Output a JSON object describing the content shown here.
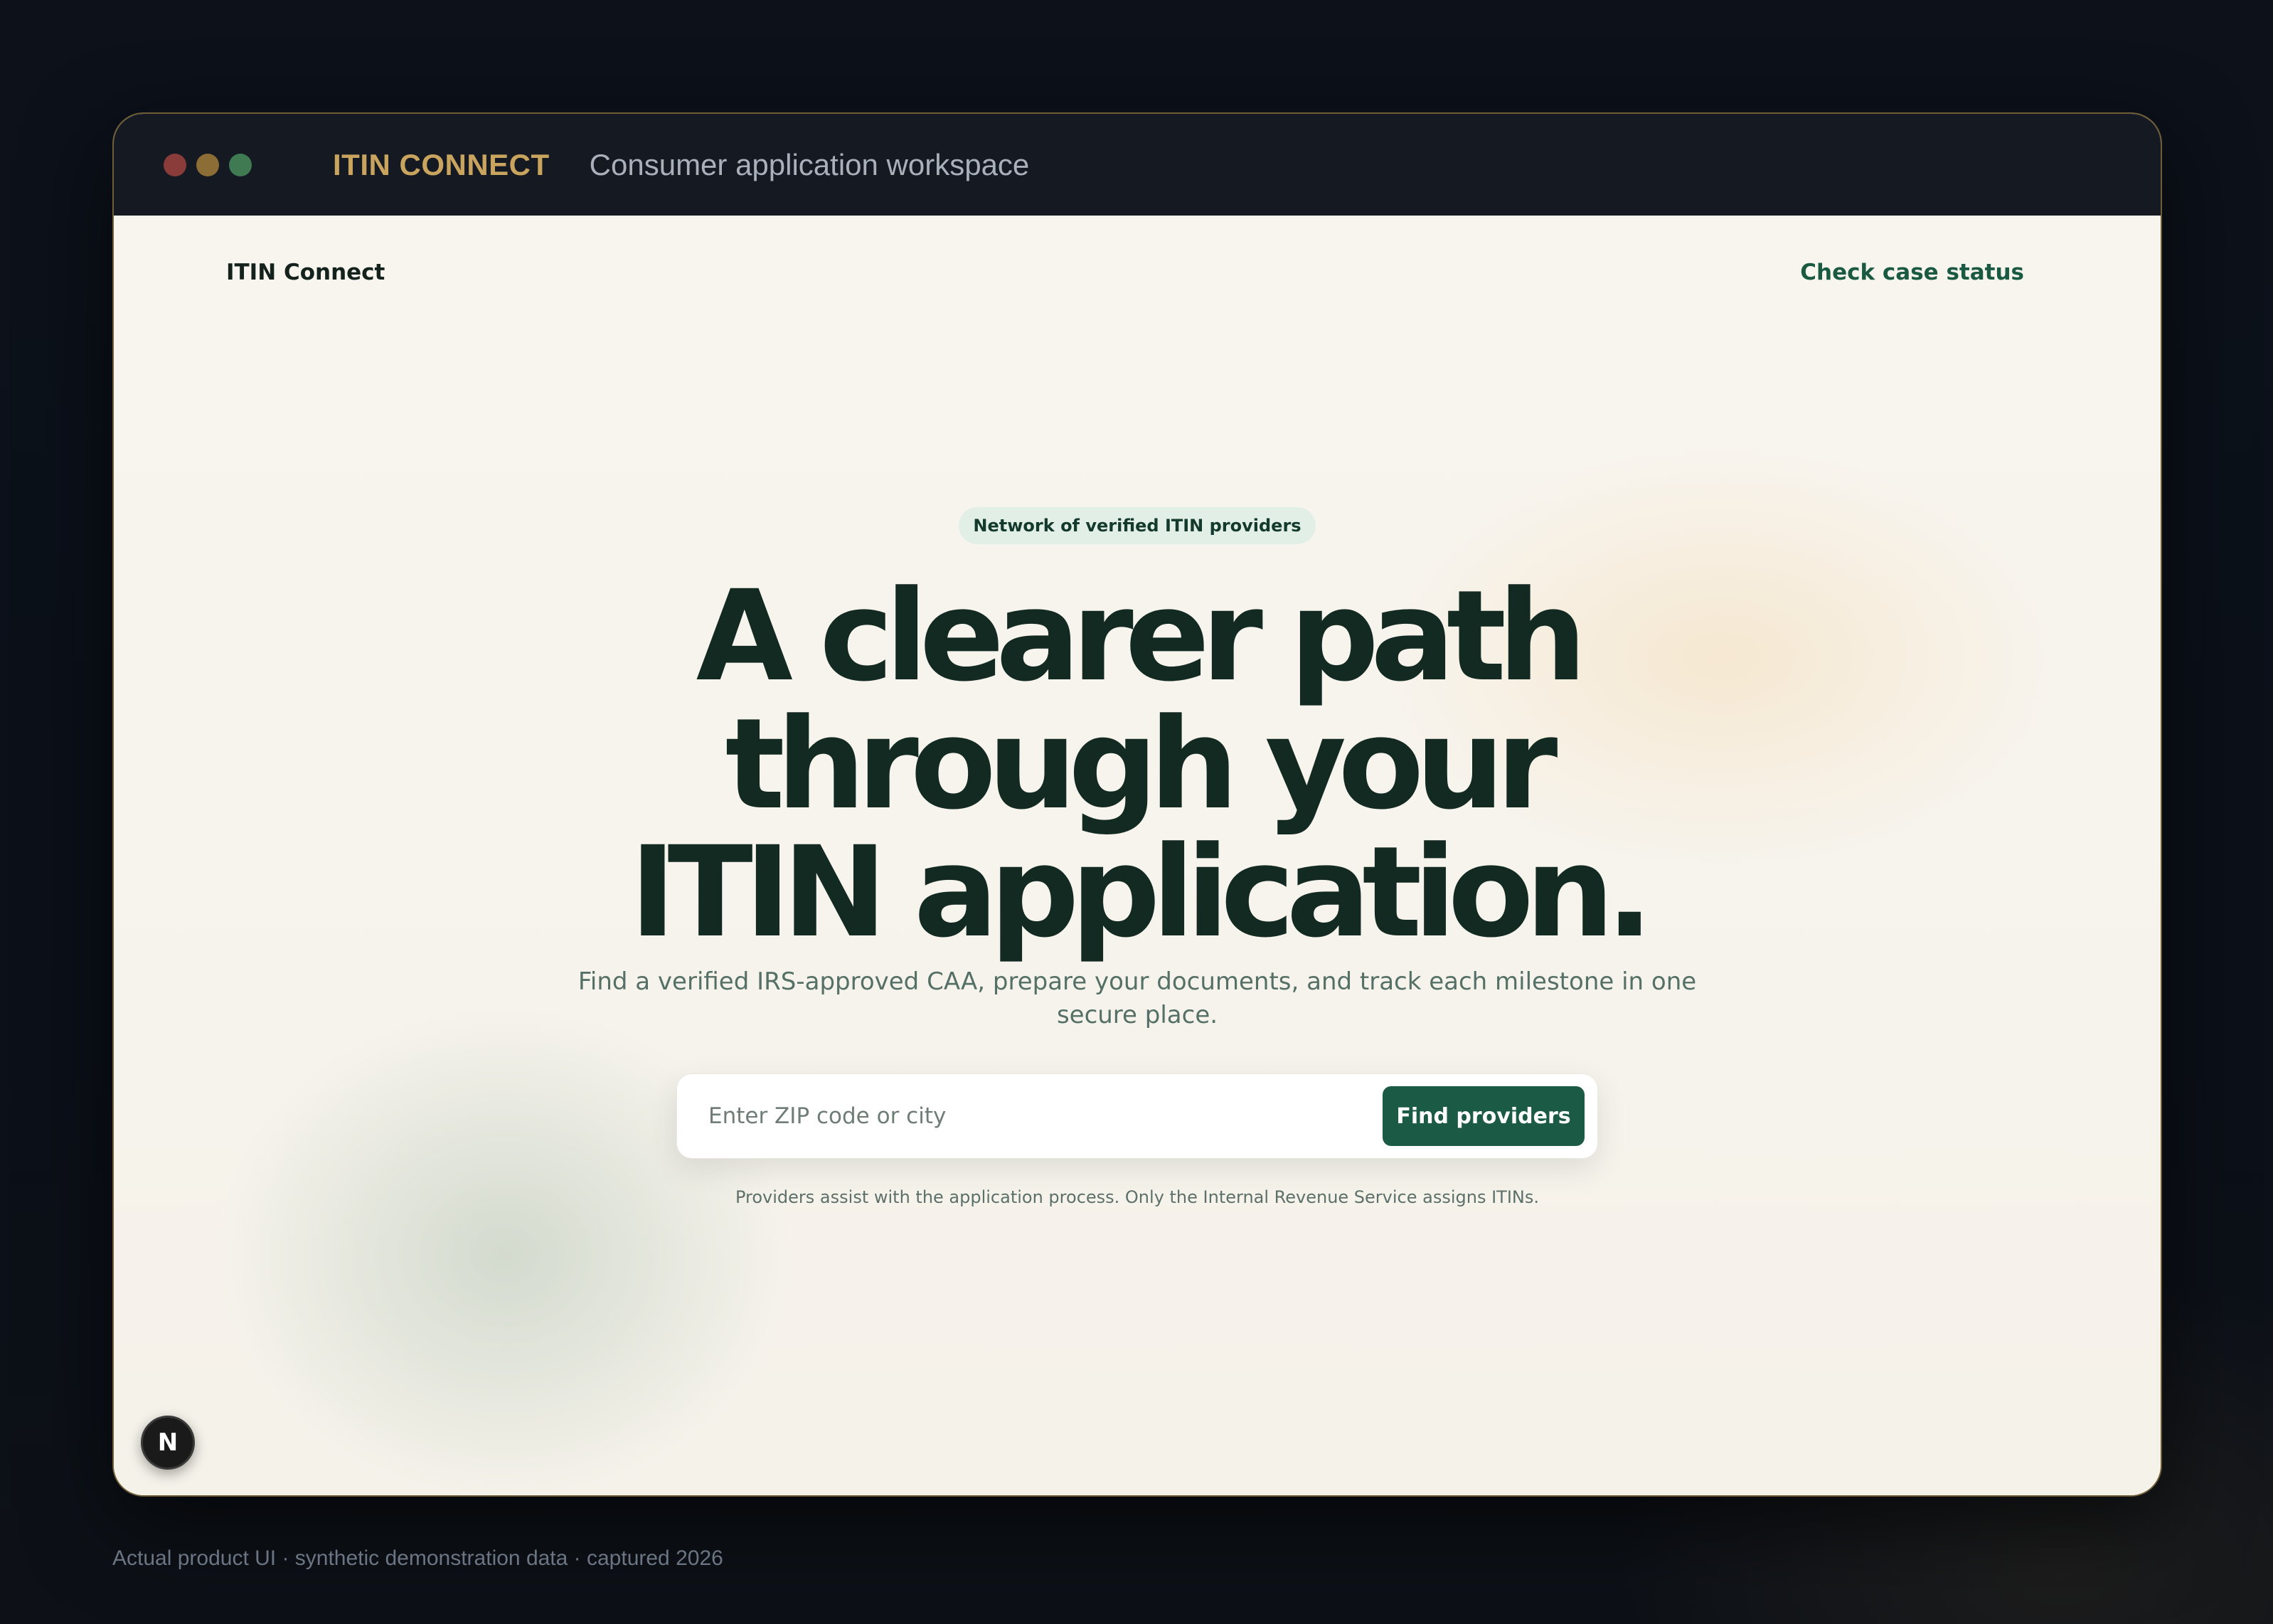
{
  "titlebar": {
    "brand": "ITIN CONNECT",
    "subtitle": "Consumer application workspace"
  },
  "nav": {
    "site_name": "ITIN Connect",
    "check_status": "Check case status"
  },
  "hero": {
    "badge": "Network of verified ITIN providers",
    "headline": "A clearer path through your ITIN application.",
    "description": "Find a verified IRS-approved CAA, prepare your documents, and track each milestone in one secure place.",
    "search_placeholder": "Enter ZIP code or city",
    "search_value": "",
    "find_button": "Find providers",
    "note": "Providers assist with the application process. Only the Internal Revenue Service assigns ITINs."
  },
  "dev_badge": "N",
  "caption": "Actual product UI · synthetic demonstration data · captured 2026",
  "colors": {
    "accent": "#1b5a45",
    "brand_gold": "#c9a45f",
    "headline": "#132a22"
  }
}
